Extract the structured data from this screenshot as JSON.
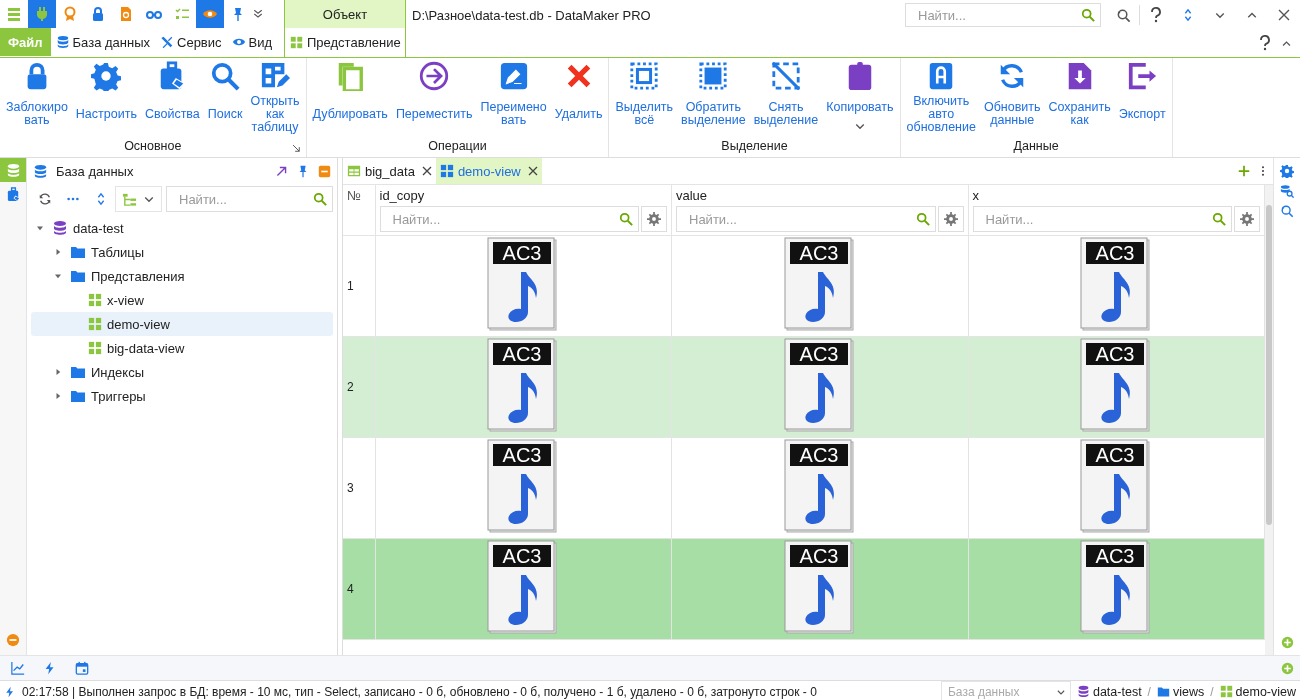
{
  "quick_access": [
    {
      "kind": "menu",
      "on": false
    },
    {
      "kind": "plug",
      "on": true
    },
    {
      "kind": "badge",
      "on": false
    },
    {
      "kind": "lock",
      "on": false
    },
    {
      "kind": "doc",
      "on": false
    },
    {
      "kind": "glasses",
      "on": false
    },
    {
      "kind": "checklist",
      "on": false
    },
    {
      "kind": "eye",
      "on": true
    },
    {
      "kind": "pin",
      "on": false
    }
  ],
  "menu_tabs": [
    {
      "label": "Файл",
      "kind": "file",
      "selected": true
    },
    {
      "label": "База данных",
      "kind": "database",
      "selected": false
    },
    {
      "label": "Сервис",
      "kind": "tools",
      "selected": false
    },
    {
      "label": "Вид",
      "kind": "eye",
      "selected": false
    }
  ],
  "context_tab": {
    "group": "Объект",
    "label": "Представление",
    "selected": true
  },
  "window": {
    "title": "D:\\Разное\\data-test.db - DataMaker PRO"
  },
  "search": {
    "placeholder": "Найти..."
  },
  "ribbon": [
    {
      "title": "Основное",
      "launcher": true,
      "buttons": [
        {
          "label": "Заблокиро\nвать",
          "kind": "lock"
        },
        {
          "label": "Настроить",
          "kind": "gear"
        },
        {
          "label": "Свойства",
          "kind": "bag"
        },
        {
          "label": "Поиск",
          "kind": "search"
        },
        {
          "label": "Открыть\nкак\nтаблицу",
          "kind": "table-edit"
        }
      ]
    },
    {
      "title": "Операции",
      "launcher": false,
      "buttons": [
        {
          "label": "Дублировать",
          "kind": "copy"
        },
        {
          "label": "Переместить",
          "kind": "move"
        },
        {
          "label": "Переимено\nвать",
          "kind": "rename"
        },
        {
          "label": "Удалить",
          "kind": "delete"
        }
      ]
    },
    {
      "title": "Выделение",
      "launcher": false,
      "buttons": [
        {
          "label": "Выделить\nвсё",
          "kind": "select-all"
        },
        {
          "label": "Обратить\nвыделение",
          "kind": "invert"
        },
        {
          "label": "Снять\nвыделение",
          "kind": "deselect"
        },
        {
          "label": "Копировать",
          "kind": "clipboard",
          "dropdown": true
        }
      ]
    },
    {
      "title": "Данные",
      "launcher": false,
      "buttons": [
        {
          "label": "Включить\nавто\nобновление",
          "kind": "auto"
        },
        {
          "label": "Обновить\nданные",
          "kind": "refresh"
        },
        {
          "label": "Сохранить\nкак",
          "kind": "save"
        },
        {
          "label": "Экспорт",
          "kind": "export"
        }
      ]
    }
  ],
  "side_strip": [
    {
      "kind": "database",
      "selected": true
    },
    {
      "kind": "bag",
      "selected": false
    }
  ],
  "panel": {
    "title": "База данных",
    "search_placeholder": "Найти...",
    "tree": [
      {
        "label": "data-test",
        "kind": "database",
        "expanded": true,
        "selected": false,
        "children": [
          {
            "label": "Таблицы",
            "kind": "folder",
            "expanded": false,
            "selected": false
          },
          {
            "label": "Представления",
            "kind": "folder",
            "expanded": true,
            "selected": false,
            "children": [
              {
                "label": "x-view",
                "kind": "view",
                "selected": false
              },
              {
                "label": "demo-view",
                "kind": "view",
                "selected": true
              },
              {
                "label": "big-data-view",
                "kind": "view",
                "selected": false
              }
            ]
          },
          {
            "label": "Индексы",
            "kind": "folder",
            "expanded": false,
            "selected": false
          },
          {
            "label": "Триггеры",
            "kind": "folder",
            "expanded": false,
            "selected": false
          }
        ]
      }
    ]
  },
  "doc_tabs": [
    {
      "label": "big_data",
      "kind": "table",
      "selected": false
    },
    {
      "label": "demo-view",
      "kind": "view",
      "selected": true
    }
  ],
  "table": {
    "number_header": "№",
    "columns": [
      {
        "name": "id_copy",
        "placeholder": "Найти..."
      },
      {
        "name": "value",
        "placeholder": "Найти..."
      },
      {
        "name": "x",
        "placeholder": "Найти..."
      }
    ],
    "rows": [
      {
        "number": "1",
        "selected": false,
        "current": false,
        "cells": [
          "AC3",
          "AC3",
          "AC3"
        ]
      },
      {
        "number": "2",
        "selected": true,
        "current": false,
        "cells": [
          "AC3",
          "AC3",
          "AC3"
        ]
      },
      {
        "number": "3",
        "selected": false,
        "current": false,
        "cells": [
          "AC3",
          "AC3",
          "AC3"
        ]
      },
      {
        "number": "4",
        "selected": true,
        "current": true,
        "cells": [
          "AC3",
          "AC3",
          "AC3"
        ]
      }
    ]
  },
  "status_bar": {
    "time": "02:17:58",
    "message": "| Выполнен запрос в БД: время - 10 мс, тип - Select, записано - 0 б, обновлено - 0 б, получено - 1 б, удалено - 0 б, затронуто строк - 0",
    "db_placeholder": "База данных",
    "path": [
      {
        "label": "data-test",
        "kind": "database"
      },
      {
        "separator": "/",
        "label": "views",
        "kind": "folder"
      },
      {
        "separator": "/",
        "label": "demo-view",
        "kind": "view"
      }
    ]
  }
}
